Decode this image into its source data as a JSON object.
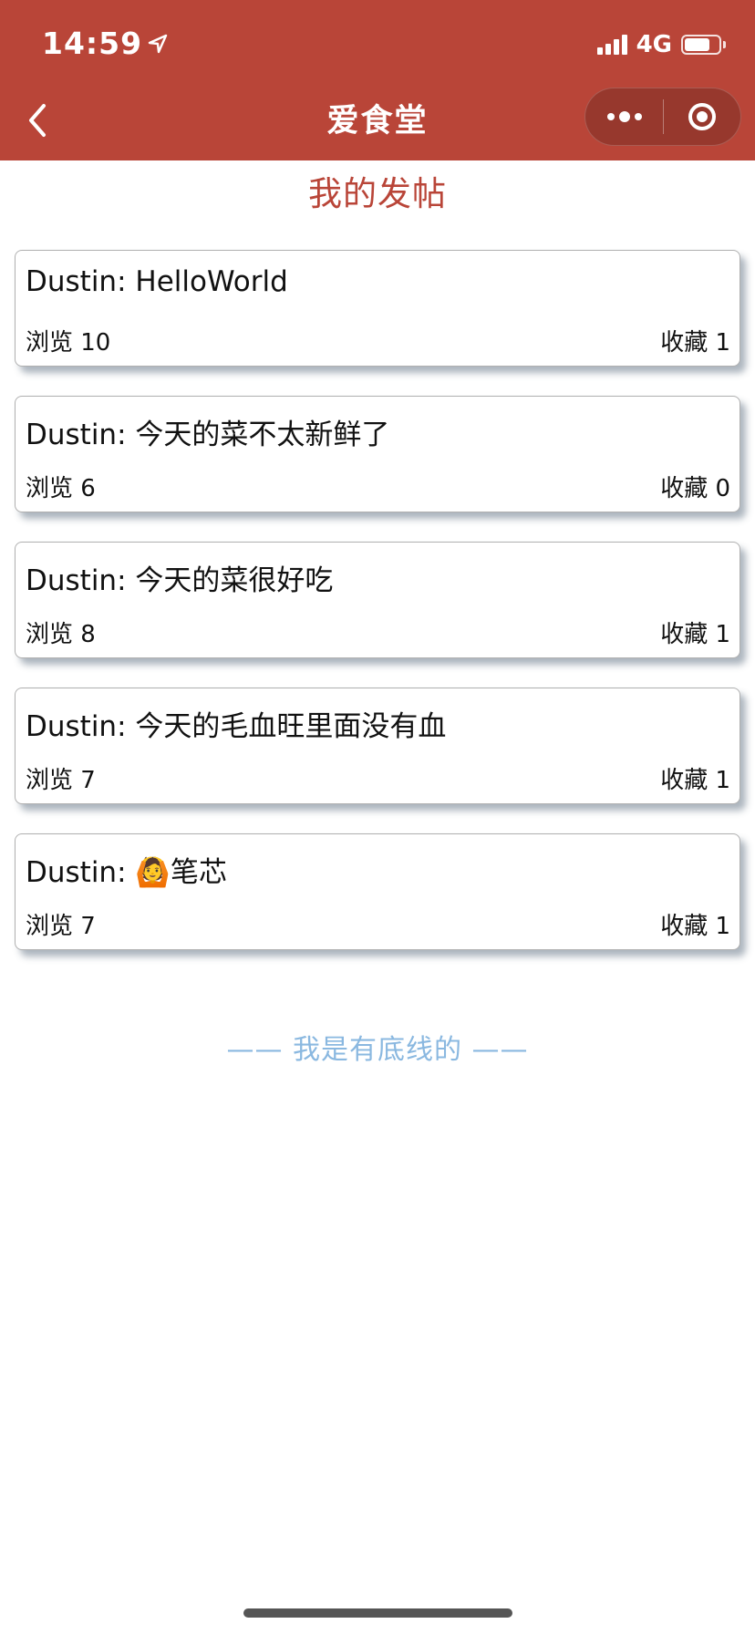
{
  "status_bar": {
    "time": "14:59",
    "network": "4G",
    "battery_level": 0.75
  },
  "nav": {
    "title": "爱食堂"
  },
  "page": {
    "title": "我的发帖"
  },
  "posts": [
    {
      "title": "Dustin: HelloWorld",
      "views": "浏览 10",
      "favorites": "收藏 1"
    },
    {
      "title": "Dustin: 今天的菜不太新鲜了",
      "views": "浏览 6",
      "favorites": "收藏 0"
    },
    {
      "title": "Dustin: 今天的菜很好吃",
      "views": "浏览 8",
      "favorites": "收藏 1"
    },
    {
      "title": "Dustin: 今天的毛血旺里面没有血",
      "views": "浏览 7",
      "favorites": "收藏 1"
    },
    {
      "title": "Dustin: 🙆笔芯",
      "views": "浏览 7",
      "favorites": "收藏 1"
    }
  ],
  "footer": {
    "text": "—— 我是有底线的 ——"
  },
  "colors": {
    "brand": "#b94538",
    "footer_text": "#8ab8e0"
  },
  "icons": {
    "location": "location-arrow-icon",
    "back": "chevron-left-icon",
    "more": "more-dots-icon",
    "close": "target-ring-icon"
  }
}
